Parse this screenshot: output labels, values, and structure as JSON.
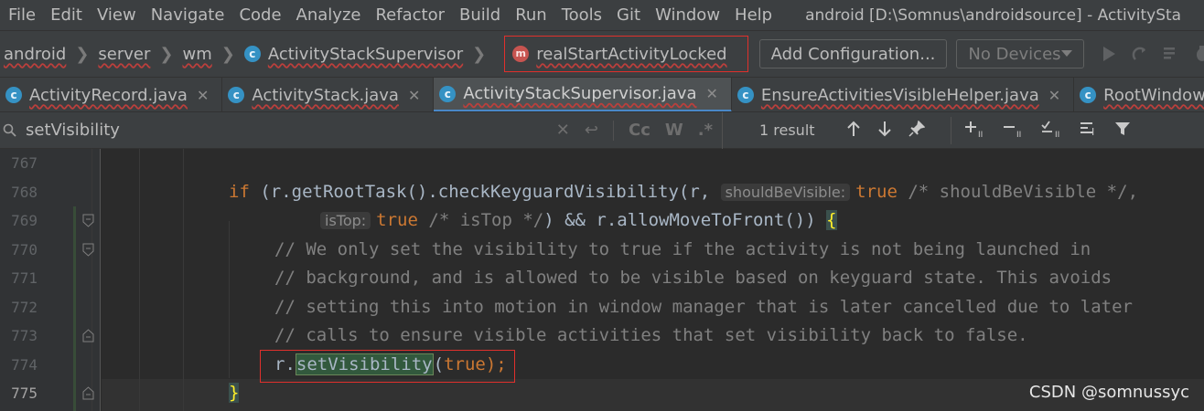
{
  "menu": {
    "items": [
      "File",
      "Edit",
      "View",
      "Navigate",
      "Code",
      "Analyze",
      "Refactor",
      "Build",
      "Run",
      "Tools",
      "Git",
      "Window",
      "Help"
    ],
    "window_title": "android [D:\\Somnus\\androidsource] - ActivitySta"
  },
  "nav": {
    "crumbs": [
      "android",
      "server",
      "wm"
    ],
    "class_crumb": "ActivityStackSupervisor",
    "method_crumb": "realStartActivityLocked",
    "config_button": "Add Configuration...",
    "devices_dropdown": "No Devices"
  },
  "tabs": [
    {
      "label": "ActivityRecord.java",
      "active": false
    },
    {
      "label": "ActivityStack.java",
      "active": false
    },
    {
      "label": "ActivityStackSupervisor.java",
      "active": true
    },
    {
      "label": "EnsureActivitiesVisibleHelper.java",
      "active": false
    },
    {
      "label": "RootWindowCon",
      "active": false
    }
  ],
  "search": {
    "query": "setVisibility",
    "match_case": "Cc",
    "words": "W",
    "regex": ".*",
    "results": "1 result"
  },
  "editor": {
    "line_numbers": [
      "767",
      "768",
      "769",
      "770",
      "771",
      "772",
      "773",
      "774",
      "775"
    ],
    "current_line": "775",
    "line768": {
      "kw": "if",
      "code": " (r.getRootTask().checkKeyguardVisibility(r, ",
      "hint": "shouldBeVisible:",
      "value": "true",
      "comment": " /* shouldBeVisible */,"
    },
    "line769": {
      "hint": "isTop:",
      "value": "true",
      "comment": " /* isTop */",
      "code": ") && r.allowMoveToFront()) ",
      "brace": "{"
    },
    "comments": [
      "// We only set the visibility to true if the activity is not being launched in",
      "// background, and is allowed to be visible based on keyguard state. This avoids",
      "// setting this into motion in window manager that is later cancelled due to later",
      "// calls to ensure visible activities that set visibility back to false."
    ],
    "line774": {
      "prefix": "r.",
      "method": "setVisibility",
      "open": "(",
      "value": "true",
      "close": ");"
    },
    "line775": {
      "brace": "}"
    }
  },
  "watermark": "CSDN @somnussyc"
}
